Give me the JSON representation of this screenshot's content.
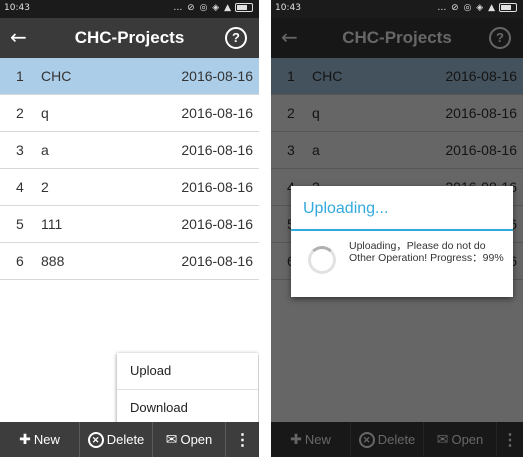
{
  "status_bar": {
    "time": "10:43",
    "icons": "… ⊘ ◎ ◈ ▲"
  },
  "header": {
    "back_glyph": "←",
    "title": "CHC-Projects",
    "help_glyph": "?"
  },
  "projects": [
    {
      "num": "1",
      "name": "CHC",
      "date": "2016-08-16"
    },
    {
      "num": "2",
      "name": "q",
      "date": "2016-08-16"
    },
    {
      "num": "3",
      "name": "a",
      "date": "2016-08-16"
    },
    {
      "num": "4",
      "name": "2",
      "date": "2016-08-16"
    },
    {
      "num": "5",
      "name": "111",
      "date": "2016-08-16"
    },
    {
      "num": "6",
      "name": "888",
      "date": "2016-08-16"
    }
  ],
  "popup_menu": {
    "upload_label": "Upload",
    "download_label": "Download"
  },
  "toolbar": {
    "new_label": "New",
    "delete_label": "Delete",
    "open_label": "Open",
    "more_glyph": "⋮"
  },
  "dialog": {
    "title": "Uploading...",
    "message": "Uploading，Please do not do Other Operation! Progress：99%",
    "progress_percent": 99
  },
  "colors": {
    "selected_row": "#abcde8",
    "title_bar": "#3a3a3a",
    "toolbar": "#3d3d3d",
    "dialog_accent": "#33aadd"
  }
}
